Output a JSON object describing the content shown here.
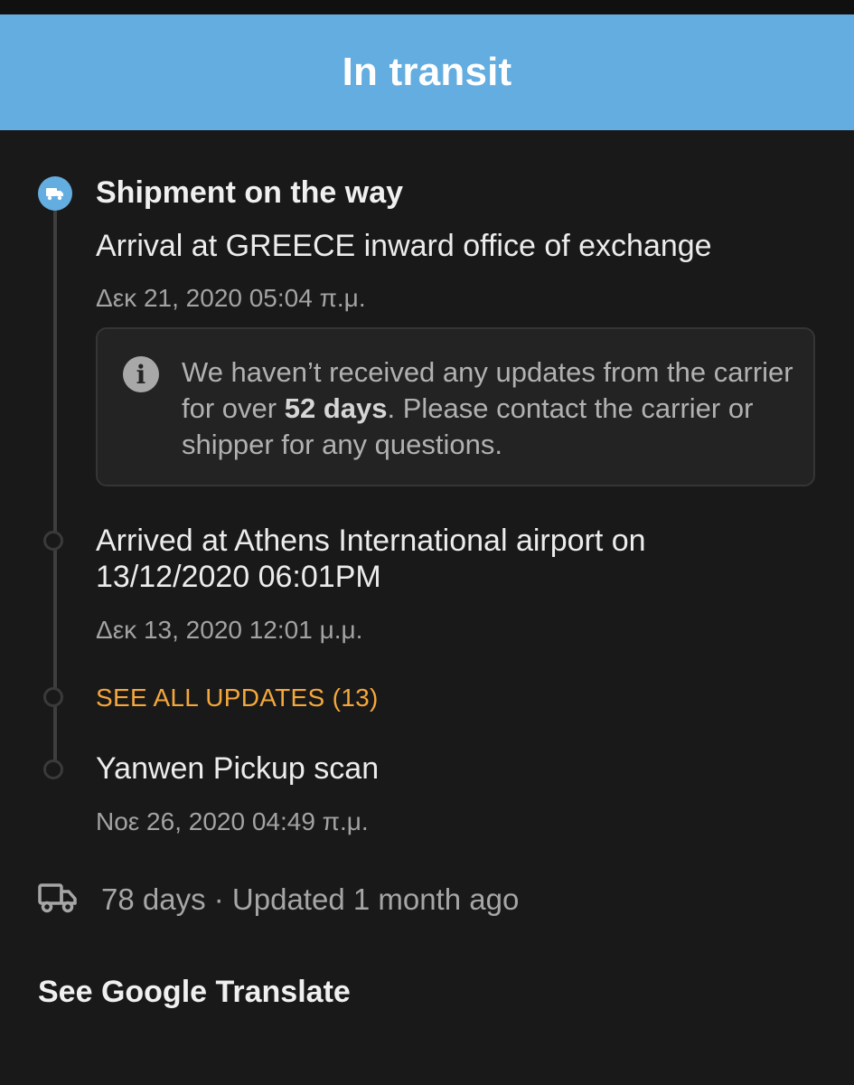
{
  "header": {
    "status_title": "In transit",
    "color": "#64ade0"
  },
  "timeline": {
    "current_step": {
      "title": "Shipment on the way",
      "icon": "truck-icon"
    },
    "events": [
      {
        "text": "Arrival at GREECE inward office of exchange",
        "time": "Δεκ 21, 2020 05:04 π.μ."
      },
      {
        "text_line1": "Arrived at Athens International airport on",
        "text_line2": "13/12/2020 06:01PM",
        "time": "Δεκ 13, 2020 12:01 μ.μ."
      },
      {
        "text": "Yanwen Pickup scan",
        "time": "Νοε 26, 2020 04:49 π.μ."
      }
    ],
    "see_all_label": "SEE ALL UPDATES (13)",
    "accent_color": "#f4a73b"
  },
  "notice": {
    "icon": "info-icon",
    "text_before": "We haven’t received any updates from the carrier for over ",
    "bold": "52 days",
    "text_after": ". Please contact the carrier or shipper for any questions."
  },
  "summary": {
    "icon": "truck-icon",
    "text": "78 days · Updated 1 month ago"
  },
  "footer": {
    "translate_label": "See Google Translate"
  }
}
